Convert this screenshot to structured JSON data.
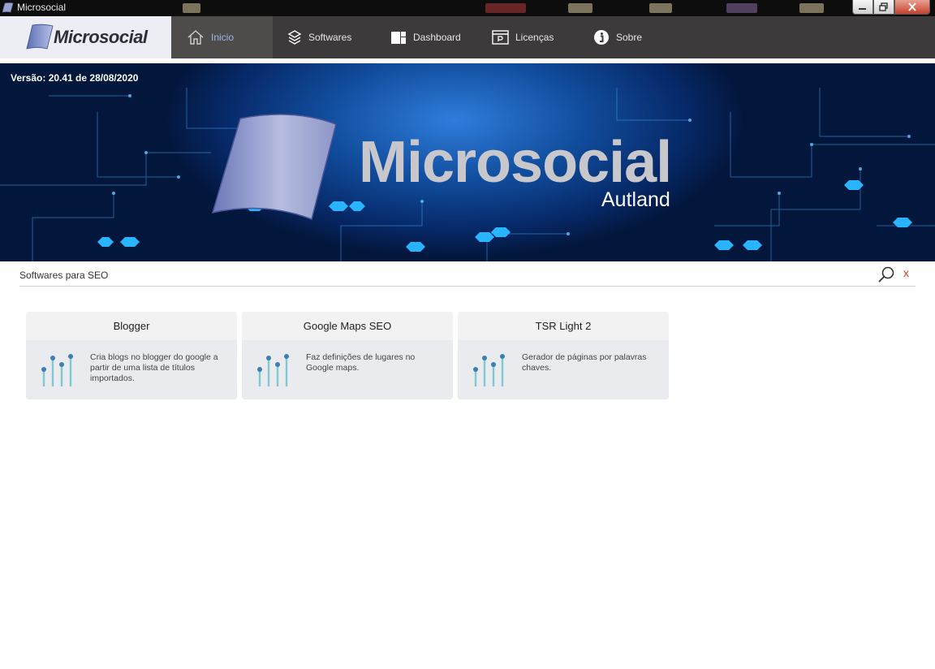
{
  "window": {
    "title": "Microsocial",
    "controls": [
      "minimize",
      "maximize",
      "close"
    ]
  },
  "nav": {
    "logo_text": "Microsocial",
    "items": [
      {
        "label": "Inicio",
        "icon": "home-icon"
      },
      {
        "label": "Softwares",
        "icon": "layers-icon"
      },
      {
        "label": "Dashboard",
        "icon": "dashboard-icon"
      },
      {
        "label": "Licenças",
        "icon": "license-icon"
      },
      {
        "label": "Sobre",
        "icon": "info-icon"
      }
    ],
    "active_index": 0
  },
  "banner": {
    "version": "Versão: 20.41 de 28/08/2020",
    "title": "Microsocial",
    "subtitle": "Autland"
  },
  "search": {
    "label": "Softwares para SEO",
    "clear": "x"
  },
  "cards": [
    {
      "title": "Blogger",
      "description": "Cria blogs no blogger do google a partir de uma lista de títulos importados."
    },
    {
      "title": "Google Maps SEO",
      "description": "Faz definições de lugares no Google maps."
    },
    {
      "title": "TSR Light 2",
      "description": "Gerador de páginas por palavras chaves."
    }
  ],
  "colors": {
    "nav_bg": "#3c3a3a",
    "nav_active_text": "#9fb6e0",
    "card_bg": "#e9ebee",
    "card_icon": "#7fcad0",
    "clear_accent": "#d13b1e"
  }
}
